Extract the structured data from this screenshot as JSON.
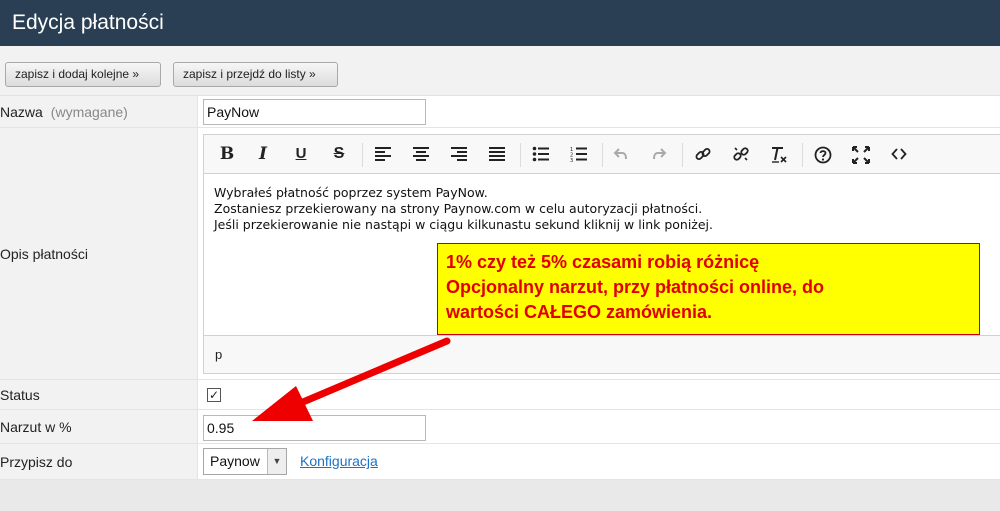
{
  "header": {
    "title": "Edycja płatności"
  },
  "actions": {
    "save_add": "zapisz i dodaj kolejne »",
    "save_list": "zapisz i przejdź do listy »"
  },
  "form": {
    "name": {
      "label": "Nazwa",
      "required": "(wymagane)",
      "value": "PayNow"
    },
    "description": {
      "label": "Opis płatności",
      "lines": [
        "Wybrałeś płatność poprzez system PayNow.",
        "Zostaniesz przekierowany na strony Paynow.com w celu autoryzacji płatności.",
        "Jeśli przekierowanie nie nastąpi w ciągu kilkunastu sekund kliknij w link poniżej."
      ],
      "status_path": "p"
    },
    "status": {
      "label": "Status",
      "checked": true,
      "check_mark": "✓"
    },
    "surcharge": {
      "label": "Narzut w %",
      "value": "0.95"
    },
    "assign": {
      "label": "Przypisz do",
      "selected": "Paynow",
      "link": "Konfiguracja"
    }
  },
  "editor_toolbar": {
    "buttons": [
      "bold-icon",
      "italic-icon",
      "underline-icon",
      "strikethrough-icon",
      "align-left-icon",
      "align-center-icon",
      "align-right-icon",
      "align-justify-icon",
      "bullet-list-icon",
      "numbered-list-icon",
      "undo-icon",
      "redo-icon",
      "link-icon",
      "unlink-icon",
      "clear-format-icon",
      "help-icon",
      "fullscreen-icon",
      "source-code-icon"
    ]
  },
  "annotation": {
    "lines": [
      "1% czy też 5% czasami robią różnicę",
      "Opcjonalny narzut, przy płatności online, do",
      "wartości CAŁEGO zamówienia."
    ],
    "colors": {
      "background": "#ffff00",
      "text": "#e00000",
      "arrow": "#ee0000"
    }
  },
  "colors": {
    "header_bg": "#2b3f54",
    "link": "#1a73c9"
  }
}
